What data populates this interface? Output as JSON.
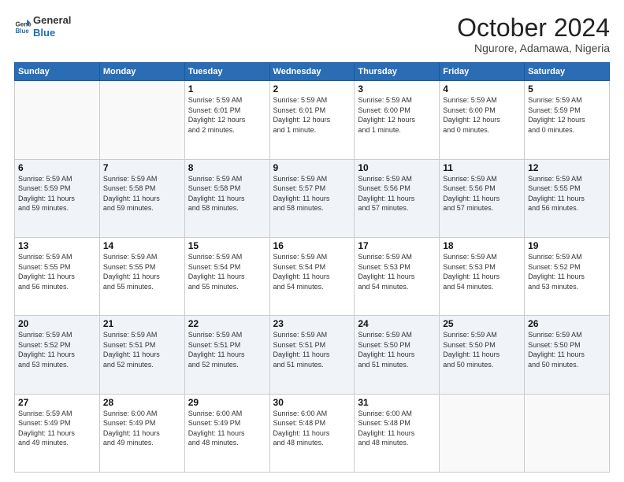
{
  "header": {
    "logo_line1": "General",
    "logo_line2": "Blue",
    "title": "October 2024",
    "location": "Ngurore, Adamawa, Nigeria"
  },
  "weekdays": [
    "Sunday",
    "Monday",
    "Tuesday",
    "Wednesday",
    "Thursday",
    "Friday",
    "Saturday"
  ],
  "weeks": [
    [
      {
        "day": "",
        "info": ""
      },
      {
        "day": "",
        "info": ""
      },
      {
        "day": "1",
        "info": "Sunrise: 5:59 AM\nSunset: 6:01 PM\nDaylight: 12 hours\nand 2 minutes."
      },
      {
        "day": "2",
        "info": "Sunrise: 5:59 AM\nSunset: 6:01 PM\nDaylight: 12 hours\nand 1 minute."
      },
      {
        "day": "3",
        "info": "Sunrise: 5:59 AM\nSunset: 6:00 PM\nDaylight: 12 hours\nand 1 minute."
      },
      {
        "day": "4",
        "info": "Sunrise: 5:59 AM\nSunset: 6:00 PM\nDaylight: 12 hours\nand 0 minutes."
      },
      {
        "day": "5",
        "info": "Sunrise: 5:59 AM\nSunset: 5:59 PM\nDaylight: 12 hours\nand 0 minutes."
      }
    ],
    [
      {
        "day": "6",
        "info": "Sunrise: 5:59 AM\nSunset: 5:59 PM\nDaylight: 11 hours\nand 59 minutes."
      },
      {
        "day": "7",
        "info": "Sunrise: 5:59 AM\nSunset: 5:58 PM\nDaylight: 11 hours\nand 59 minutes."
      },
      {
        "day": "8",
        "info": "Sunrise: 5:59 AM\nSunset: 5:58 PM\nDaylight: 11 hours\nand 58 minutes."
      },
      {
        "day": "9",
        "info": "Sunrise: 5:59 AM\nSunset: 5:57 PM\nDaylight: 11 hours\nand 58 minutes."
      },
      {
        "day": "10",
        "info": "Sunrise: 5:59 AM\nSunset: 5:56 PM\nDaylight: 11 hours\nand 57 minutes."
      },
      {
        "day": "11",
        "info": "Sunrise: 5:59 AM\nSunset: 5:56 PM\nDaylight: 11 hours\nand 57 minutes."
      },
      {
        "day": "12",
        "info": "Sunrise: 5:59 AM\nSunset: 5:55 PM\nDaylight: 11 hours\nand 56 minutes."
      }
    ],
    [
      {
        "day": "13",
        "info": "Sunrise: 5:59 AM\nSunset: 5:55 PM\nDaylight: 11 hours\nand 56 minutes."
      },
      {
        "day": "14",
        "info": "Sunrise: 5:59 AM\nSunset: 5:55 PM\nDaylight: 11 hours\nand 55 minutes."
      },
      {
        "day": "15",
        "info": "Sunrise: 5:59 AM\nSunset: 5:54 PM\nDaylight: 11 hours\nand 55 minutes."
      },
      {
        "day": "16",
        "info": "Sunrise: 5:59 AM\nSunset: 5:54 PM\nDaylight: 11 hours\nand 54 minutes."
      },
      {
        "day": "17",
        "info": "Sunrise: 5:59 AM\nSunset: 5:53 PM\nDaylight: 11 hours\nand 54 minutes."
      },
      {
        "day": "18",
        "info": "Sunrise: 5:59 AM\nSunset: 5:53 PM\nDaylight: 11 hours\nand 54 minutes."
      },
      {
        "day": "19",
        "info": "Sunrise: 5:59 AM\nSunset: 5:52 PM\nDaylight: 11 hours\nand 53 minutes."
      }
    ],
    [
      {
        "day": "20",
        "info": "Sunrise: 5:59 AM\nSunset: 5:52 PM\nDaylight: 11 hours\nand 53 minutes."
      },
      {
        "day": "21",
        "info": "Sunrise: 5:59 AM\nSunset: 5:51 PM\nDaylight: 11 hours\nand 52 minutes."
      },
      {
        "day": "22",
        "info": "Sunrise: 5:59 AM\nSunset: 5:51 PM\nDaylight: 11 hours\nand 52 minutes."
      },
      {
        "day": "23",
        "info": "Sunrise: 5:59 AM\nSunset: 5:51 PM\nDaylight: 11 hours\nand 51 minutes."
      },
      {
        "day": "24",
        "info": "Sunrise: 5:59 AM\nSunset: 5:50 PM\nDaylight: 11 hours\nand 51 minutes."
      },
      {
        "day": "25",
        "info": "Sunrise: 5:59 AM\nSunset: 5:50 PM\nDaylight: 11 hours\nand 50 minutes."
      },
      {
        "day": "26",
        "info": "Sunrise: 5:59 AM\nSunset: 5:50 PM\nDaylight: 11 hours\nand 50 minutes."
      }
    ],
    [
      {
        "day": "27",
        "info": "Sunrise: 5:59 AM\nSunset: 5:49 PM\nDaylight: 11 hours\nand 49 minutes."
      },
      {
        "day": "28",
        "info": "Sunrise: 6:00 AM\nSunset: 5:49 PM\nDaylight: 11 hours\nand 49 minutes."
      },
      {
        "day": "29",
        "info": "Sunrise: 6:00 AM\nSunset: 5:49 PM\nDaylight: 11 hours\nand 48 minutes."
      },
      {
        "day": "30",
        "info": "Sunrise: 6:00 AM\nSunset: 5:48 PM\nDaylight: 11 hours\nand 48 minutes."
      },
      {
        "day": "31",
        "info": "Sunrise: 6:00 AM\nSunset: 5:48 PM\nDaylight: 11 hours\nand 48 minutes."
      },
      {
        "day": "",
        "info": ""
      },
      {
        "day": "",
        "info": ""
      }
    ]
  ],
  "colors": {
    "header_bg": "#2a6db5",
    "logo_blue": "#1a6db5"
  }
}
